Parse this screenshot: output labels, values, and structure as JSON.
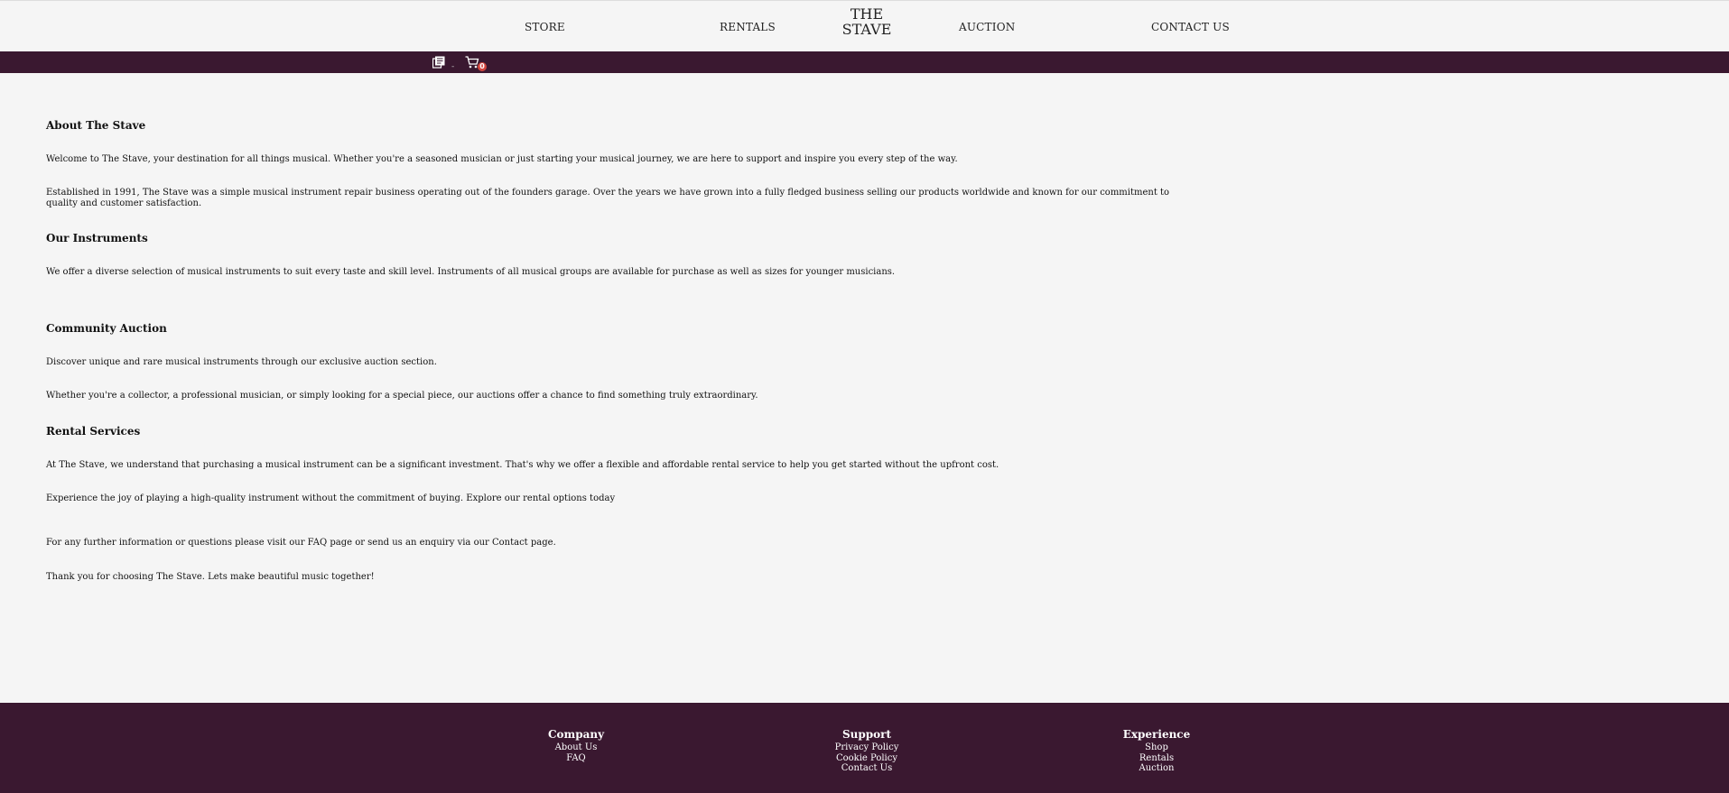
{
  "nav": {
    "store": "STORE",
    "rentals": "RENTALS",
    "logo_line1": "THE",
    "logo_line2": "STAVE",
    "auction": "AUCTION",
    "contact": "CONTACT US"
  },
  "toolbar": {
    "library_icon": "library-books-icon",
    "library_suffix": "-",
    "cart_icon": "cart-icon",
    "cart_count": "0",
    "colors": {
      "bar": "#3a1830",
      "badge": "#d2463f"
    }
  },
  "about": {
    "heading": "About The Stave",
    "p1": "Welcome to The Stave, your destination for all things musical. Whether you're a seasoned musician or just starting your musical journey, we are here to support and inspire you every step of the way.",
    "p2": "Established in 1991, The Stave was a simple musical instrument repair business operating out of the founders garage. Over the years we have grown into a fully fledged business selling our products worldwide and known for our commitment to quality and customer satisfaction."
  },
  "instruments": {
    "heading": "Our Instruments",
    "p1": "We offer a diverse selection of musical instruments to suit every taste and skill level. Instruments of all musical groups are available for purchase as well as sizes for younger musicians."
  },
  "auction": {
    "heading": "Community Auction",
    "p1": "Discover unique and rare musical instruments through our exclusive auction section.",
    "p2": "Whether you're a collector, a professional musician, or simply looking for a special piece, our auctions offer a chance to find something truly extraordinary."
  },
  "rental": {
    "heading": "Rental Services",
    "p1": "At The Stave, we understand that purchasing a musical instrument can be a significant investment. That's why we offer a flexible and affordable rental service to help you get started without the upfront cost.",
    "p2": "Experience the joy of playing a high-quality instrument without the commitment of buying. Explore our rental options today"
  },
  "closing": {
    "p1": "For any further information or questions please visit our FAQ page or send us an enquiry via our Contact page.",
    "p2": "Thank you for choosing The Stave. Lets make beautiful music together!"
  },
  "footer": {
    "company": {
      "title": "Company",
      "links": [
        "About Us",
        "FAQ"
      ]
    },
    "support": {
      "title": "Support",
      "links": [
        "Privacy Policy",
        "Cookie Policy",
        "Contact Us"
      ]
    },
    "experience": {
      "title": "Experience",
      "links": [
        "Shop",
        "Rentals",
        "Auction"
      ]
    }
  }
}
